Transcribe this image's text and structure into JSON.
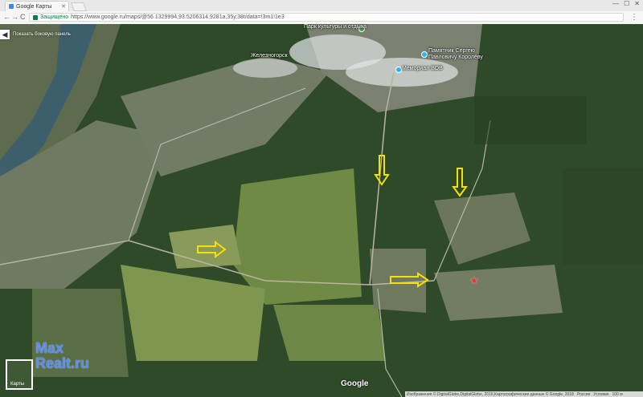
{
  "browser": {
    "tab_title": "Google Карты",
    "tab_close": "✕",
    "window_buttons": [
      "—",
      "☐",
      "✕"
    ],
    "back": "←",
    "forward": "→",
    "reload": "C",
    "secure_label": "Защищено",
    "url": "https://www.google.ru/maps/@56.1329994,93.5206314,9281a,35y,38t/data=!3m1!1e3",
    "menu": "⋮"
  },
  "map": {
    "show_sidebar_label": "Показать боковую панель",
    "sidebar_button": "◀",
    "places": [
      {
        "label": "Железногорск"
      },
      {
        "label": "Памятник Сергею Павловичу Королёву"
      },
      {
        "label": "Мемориал ВОВ"
      },
      {
        "label": "Парк культуры и отдыха"
      }
    ],
    "layer_label": "Карты",
    "google_logo": "Google",
    "footer": [
      "Изображения © DigitalGlobe,DigitalGlobe, 2016,Картографические данные © Google, 2018",
      "Россия",
      "Условия",
      "100 м"
    ],
    "marker": "★",
    "colors": {
      "arrow": "#f7e000",
      "marker": "#e53935",
      "forest": "#2e4a26",
      "river": "#3d5f6c"
    }
  },
  "watermark": {
    "line1": "Max",
    "line2": "Realt.ru"
  }
}
